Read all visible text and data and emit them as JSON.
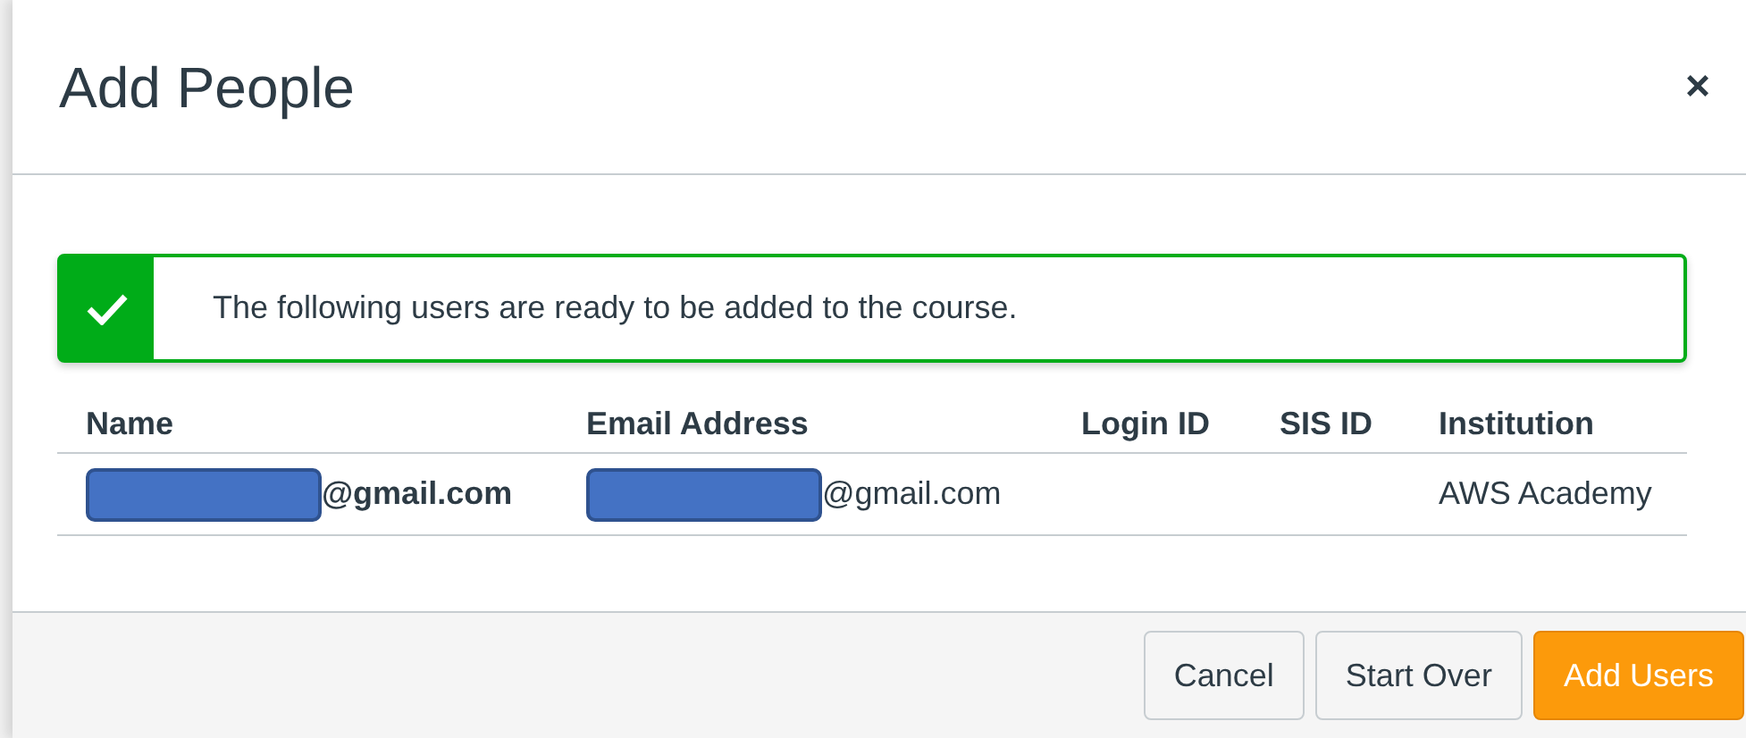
{
  "dialog": {
    "title": "Add People",
    "close": "×"
  },
  "alert": {
    "message": "The following users are ready to be added to the course."
  },
  "table": {
    "columns": [
      "Name",
      "Email Address",
      "Login ID",
      "SIS ID",
      "Institution"
    ],
    "rows": [
      {
        "name": {
          "text": "@gmail.com",
          "redacted": true
        },
        "email": {
          "text": "@gmail.com",
          "redacted": true
        },
        "institution": "AWS Academy"
      }
    ]
  },
  "buttons": [
    {
      "label": "Cancel",
      "kind": "secondary"
    },
    {
      "label": "Start Over",
      "kind": "secondary"
    },
    {
      "label": "Add Users",
      "kind": "primary"
    }
  ]
}
